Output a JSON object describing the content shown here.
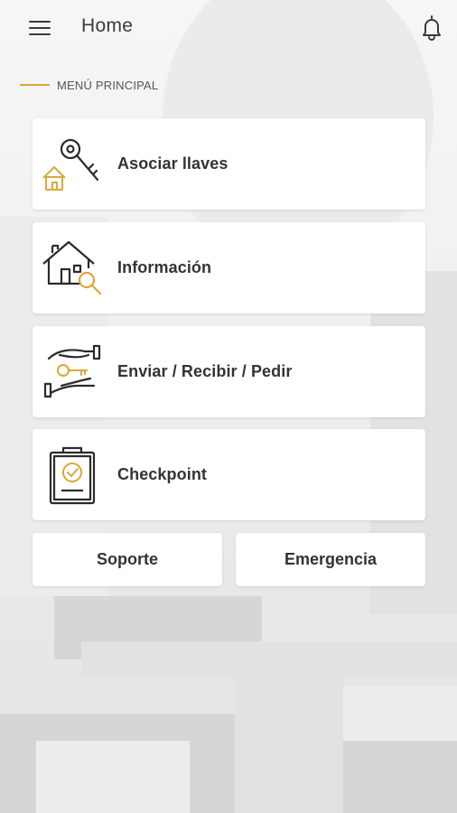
{
  "app_bar": {
    "title": "Home",
    "menu_icon": "hamburger-menu-icon",
    "bell_icon": "notification-bell-icon"
  },
  "section": {
    "label": "MENÚ PRINCIPAL",
    "accent_color": "#d9a83a"
  },
  "menu_items": [
    {
      "label": "Asociar llaves",
      "icon": "house-key-icon"
    },
    {
      "label": "Información",
      "icon": "house-search-icon"
    },
    {
      "label": "Enviar / Recibir / Pedir",
      "icon": "hand-key-exchange-icon"
    },
    {
      "label": "Checkpoint",
      "icon": "clipboard-check-icon"
    }
  ],
  "buttons": {
    "support": "Soporte",
    "emergency": "Emergencia"
  }
}
